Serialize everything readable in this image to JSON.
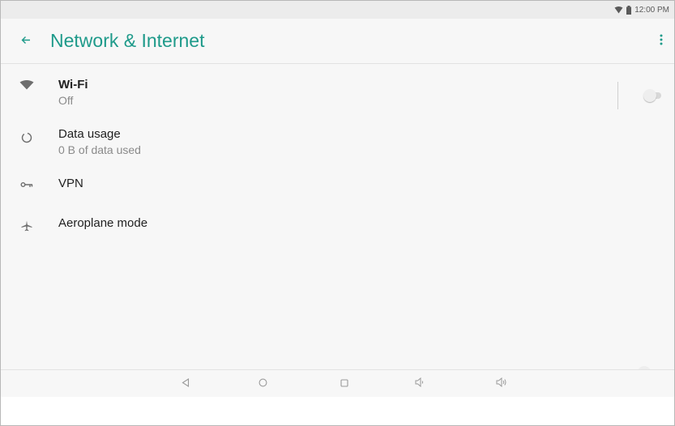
{
  "status_bar": {
    "time": "12:00 PM",
    "icons": [
      "wifi-signal-icon",
      "battery-icon"
    ]
  },
  "app_bar": {
    "title": "Network & Internet",
    "back_icon": "arrow-left-icon",
    "menu_icon": "more-vertical-icon"
  },
  "settings": {
    "items": [
      {
        "icon": "wifi-icon",
        "title": "Wi-Fi",
        "subtitle": "Off",
        "toggle": "off"
      },
      {
        "icon": "data-usage-icon",
        "title": "Data usage",
        "subtitle": "0 B of data used"
      },
      {
        "icon": "vpn-key-icon",
        "title": "VPN"
      },
      {
        "icon": "airplane-icon",
        "title": "Aeroplane mode",
        "toggle": "off"
      }
    ]
  },
  "nav_bar": {
    "buttons": [
      "back-triangle-icon",
      "home-circle-icon",
      "recents-square-icon",
      "volume-down-icon",
      "volume-up-icon"
    ]
  },
  "colors": {
    "accent": "#1e9a8a",
    "background": "#f7f7f7",
    "status_bar": "#ececec",
    "text_primary": "#212121",
    "text_secondary": "#8a8a8a"
  }
}
